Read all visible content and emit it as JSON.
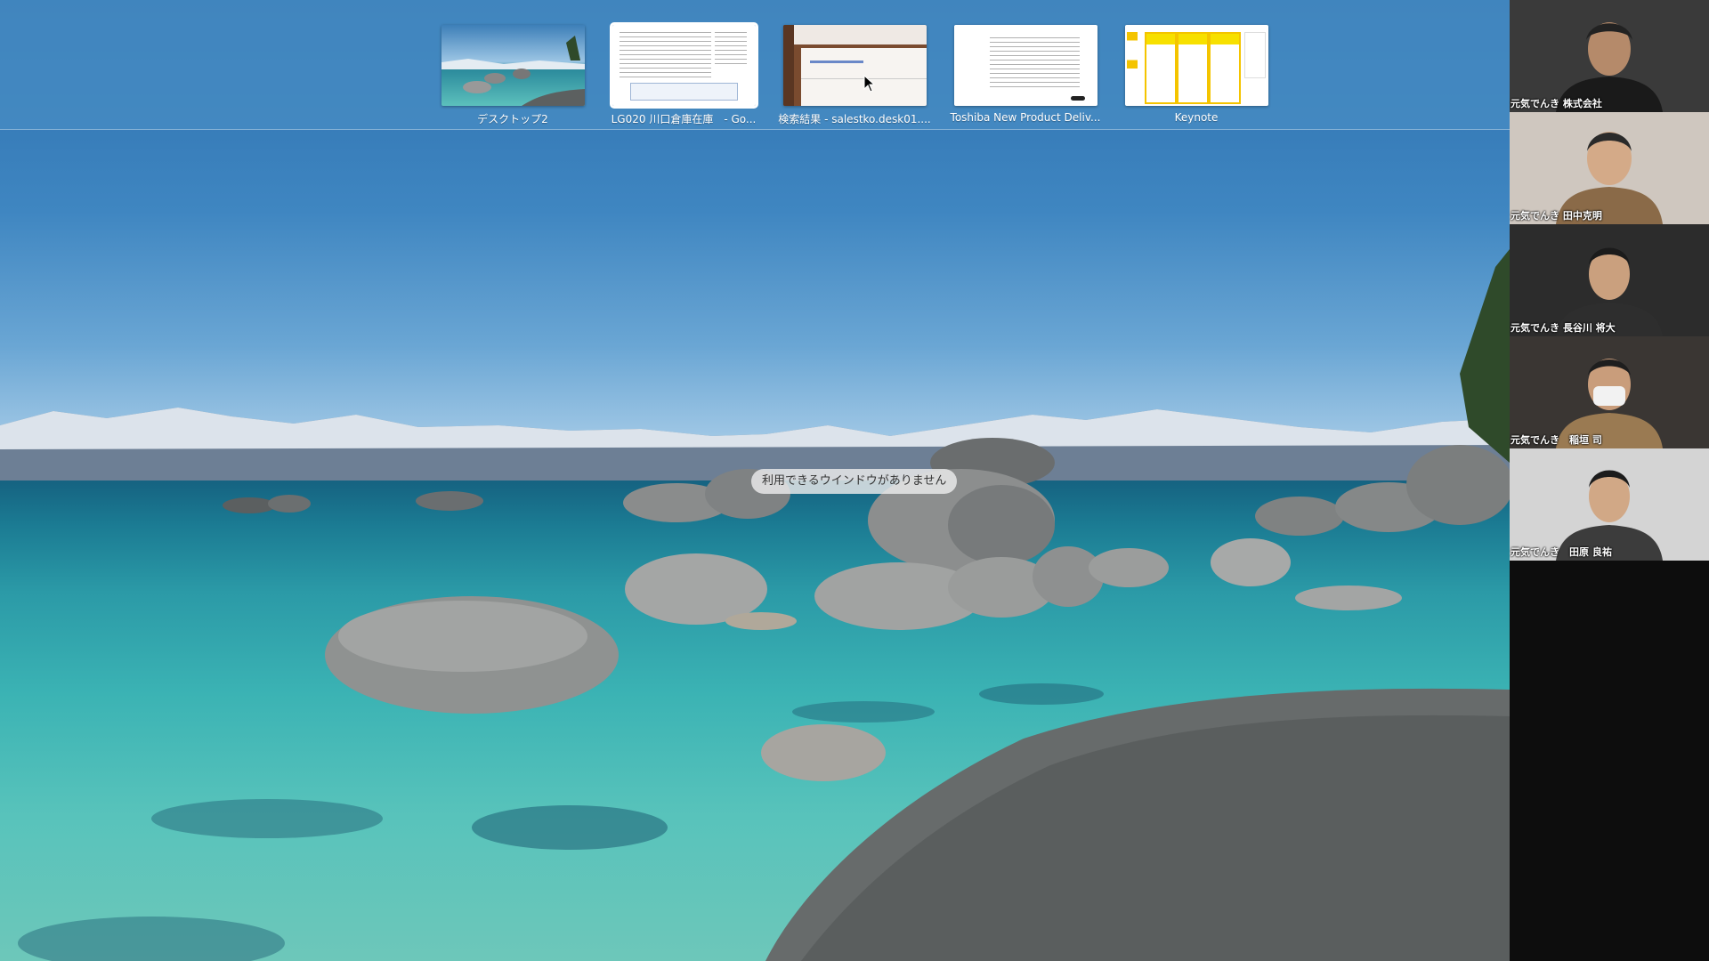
{
  "spaces_bar": {
    "spaces": [
      {
        "label": "デスクトップ2",
        "kind": "desktop",
        "selected": false
      },
      {
        "label": "LG020 川口倉庫在庫　- Go...",
        "kind": "document",
        "selected": true
      },
      {
        "label": "検索結果 - salestko.desk01....",
        "kind": "web",
        "selected": false
      },
      {
        "label": "Toshiba New Product Deliv...",
        "kind": "document",
        "selected": false
      },
      {
        "label": "Keynote",
        "kind": "keynote",
        "selected": false
      }
    ]
  },
  "desktop": {
    "no_windows_message": "利用できるウインドウがありません"
  },
  "participants": [
    {
      "name": "元気でんき 株式会社"
    },
    {
      "name": "元気でんき 田中克明"
    },
    {
      "name": "元気でんき 長谷川 将大"
    },
    {
      "name": "元気でんき　稲垣 司"
    },
    {
      "name": "元気でんき　田原 良祐"
    }
  ],
  "icons": {
    "cursor": "arrow-cursor-icon"
  }
}
